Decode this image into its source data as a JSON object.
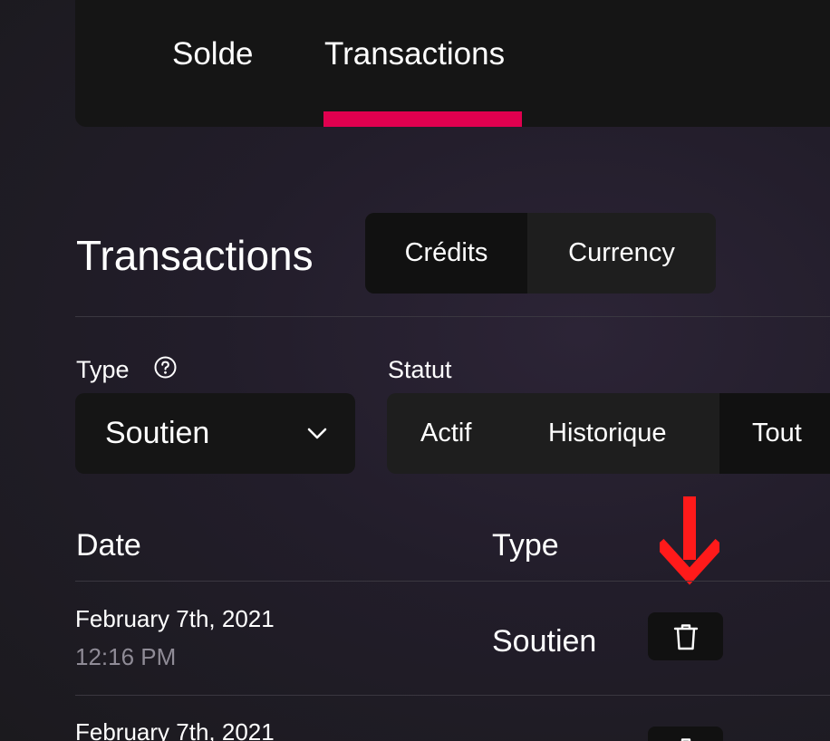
{
  "top_tabs": {
    "solde_label": "Solde",
    "transactions_label": "Transactions",
    "active": "Transactions",
    "accent_color": "#e0004f"
  },
  "section": {
    "title": "Transactions",
    "segments": {
      "credits_label": "Crédits",
      "currency_label": "Currency",
      "active": "Crédits"
    }
  },
  "filters": {
    "type": {
      "label": "Type",
      "help_icon": "help-circle-icon",
      "selected_value": "Soutien",
      "chevron_icon": "chevron-down-icon"
    },
    "status": {
      "label": "Statut",
      "options": [
        "Actif",
        "Historique",
        "Tout"
      ],
      "active": "Tout"
    }
  },
  "table": {
    "columns": {
      "date": "Date",
      "type": "Type"
    },
    "rows": [
      {
        "date": "February 7th, 2021",
        "time": "12:16 PM",
        "type": "Soutien",
        "action_icon": "trash-icon"
      },
      {
        "date": "February 7th, 2021",
        "action_icon": "trash-icon"
      }
    ]
  },
  "annotation": {
    "icon": "arrow-down-icon",
    "color": "#ff1a1a"
  }
}
